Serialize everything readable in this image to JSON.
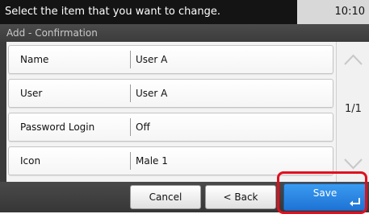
{
  "status": {
    "message": "Select the item that you want to change.",
    "time": "10:10"
  },
  "title": "Add - Confirmation",
  "rows": [
    {
      "label": "Name",
      "value": "User A"
    },
    {
      "label": "User",
      "value": "User A"
    },
    {
      "label": "Password Login",
      "value": "Off"
    },
    {
      "label": "Icon",
      "value": "Male 1"
    }
  ],
  "scroll": {
    "page_indicator": "1/1",
    "up_icon": "chevron-up-icon",
    "down_icon": "chevron-down-icon"
  },
  "buttons": {
    "cancel": "Cancel",
    "back": "< Back",
    "save": "Save",
    "save_icon": "enter-icon"
  },
  "colors": {
    "save_accent": "#1e73d4",
    "highlight": "#e0101e"
  }
}
